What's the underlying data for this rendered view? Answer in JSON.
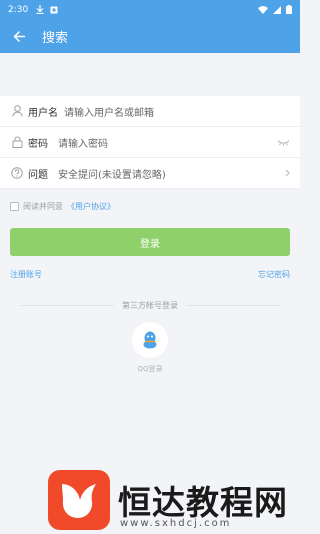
{
  "status_bar": {
    "time": "2:30"
  },
  "app_bar": {
    "title": "搜索"
  },
  "form": {
    "username": {
      "label": "用户名",
      "placeholder": "请输入用户名或邮箱"
    },
    "password": {
      "label": "密码",
      "placeholder": "请输入密码"
    },
    "question": {
      "label": "问题",
      "value": "安全提问(未设置请忽略)"
    }
  },
  "agreement": {
    "text": "阅读并同意",
    "link": "《用户协议》"
  },
  "login_button": {
    "label": "登录"
  },
  "links": {
    "register": "注册账号",
    "forgot": "忘记密码"
  },
  "third_party": {
    "title": "第三方帐号登录",
    "qq_label": "QQ登录"
  },
  "watermark": {
    "brand": "恒达教程网",
    "url": "www.sxhdcj.com"
  },
  "colors": {
    "primary": "#4ea2e8",
    "login_green": "#8fd06a",
    "logo_red": "#f04a2a"
  }
}
